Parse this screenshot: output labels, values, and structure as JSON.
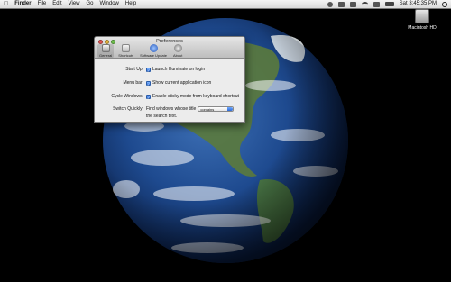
{
  "menubar": {
    "apple": "",
    "app_name": "Finder",
    "menus": [
      "File",
      "Edit",
      "View",
      "Go",
      "Window",
      "Help"
    ],
    "clock": "Sat 3:45:35 PM"
  },
  "desktop": {
    "hd_label": "Macintosh HD"
  },
  "window": {
    "title": "Preferences",
    "toolbar": [
      {
        "label": "General",
        "icon": "general-icon",
        "selected": true
      },
      {
        "label": "Shortcuts",
        "icon": "shortcuts-icon",
        "selected": false
      },
      {
        "label": "Software Update",
        "icon": "software-update-icon",
        "selected": false
      },
      {
        "label": "About",
        "icon": "about-icon",
        "selected": false
      }
    ],
    "rows": {
      "startup": {
        "label": "Start Up:",
        "option": "Launch Illuminate on login",
        "checked": true
      },
      "menubar": {
        "label": "Menu bar:",
        "option": "Show current application icon",
        "checked": true
      },
      "cycle": {
        "label": "Cycle Windows:",
        "option": "Enable sticky mode from keyboard shortcut",
        "checked": true
      },
      "switch": {
        "label": "Switch Quickly:",
        "prefix": "Find windows whose title",
        "select_value": "contains",
        "suffix": "the search text."
      }
    }
  }
}
